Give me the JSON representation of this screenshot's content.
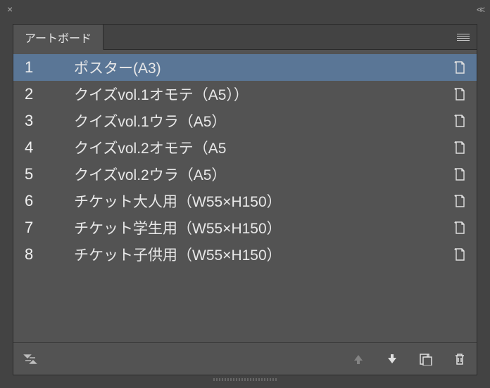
{
  "titlebar": {
    "close": "×",
    "collapse": "<<"
  },
  "panel": {
    "tab_label": "アートボード"
  },
  "artboards": [
    {
      "num": "1",
      "name": "ポスター(A3)",
      "selected": true
    },
    {
      "num": "2",
      "name": "クイズvol.1オモテ（A5））",
      "selected": false
    },
    {
      "num": "3",
      "name": "クイズvol.1ウラ（A5）",
      "selected": false
    },
    {
      "num": "4",
      "name": "クイズvol.2オモテ（A5",
      "selected": false
    },
    {
      "num": "5",
      "name": "クイズvol.2ウラ（A5）",
      "selected": false
    },
    {
      "num": "6",
      "name": "チケット大人用（W55×H150）",
      "selected": false
    },
    {
      "num": "7",
      "name": "チケット学生用（W55×H150）",
      "selected": false
    },
    {
      "num": "8",
      "name": "チケット子供用（W55×H150）",
      "selected": false
    }
  ],
  "icons": {
    "orientation": "portrait-page-icon",
    "rearrange": "rearrange-icon",
    "move_up": "arrow-up-icon",
    "move_down": "arrow-down-icon",
    "new_artboard": "new-artboard-icon",
    "delete": "trash-icon",
    "menu": "panel-menu-icon"
  },
  "colors": {
    "selected_bg": "#5a7696",
    "panel_bg": "#535353",
    "outer_bg": "#434343",
    "text": "#e8e8e8"
  }
}
